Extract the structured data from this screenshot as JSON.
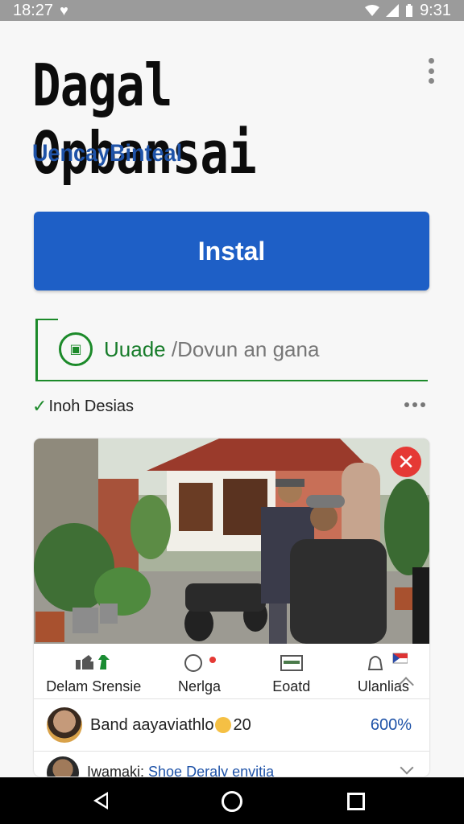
{
  "status_bar": {
    "time_left": "18:27",
    "time_right": "9:31"
  },
  "app": {
    "title": "Dagal Opbansai",
    "developer": "UencayBinteal",
    "install_label": "Instal",
    "update_label_green": "Uuade",
    "update_label_rest": " /Dovun an gana",
    "info_label": "Inoh Desias"
  },
  "post": {
    "actions": [
      {
        "label": "Delam Srensie",
        "icon": "thumbs-up-icon"
      },
      {
        "label": "Nerlga",
        "icon": "share-icon"
      },
      {
        "label": "Eoatd",
        "icon": "card-icon"
      },
      {
        "label": "Ulanlias",
        "icon": "bell-icon"
      }
    ],
    "comment1_text": "Band aayaviathlo",
    "comment1_count": "20",
    "comment1_percent": "600%",
    "comment2_prefix": "Iwamaki: ",
    "comment2_link": "Shoe Deraly envitia"
  },
  "colors": {
    "accent": "#1e5fc6",
    "update_green": "#1c8a2a",
    "close_red": "#e53935"
  }
}
